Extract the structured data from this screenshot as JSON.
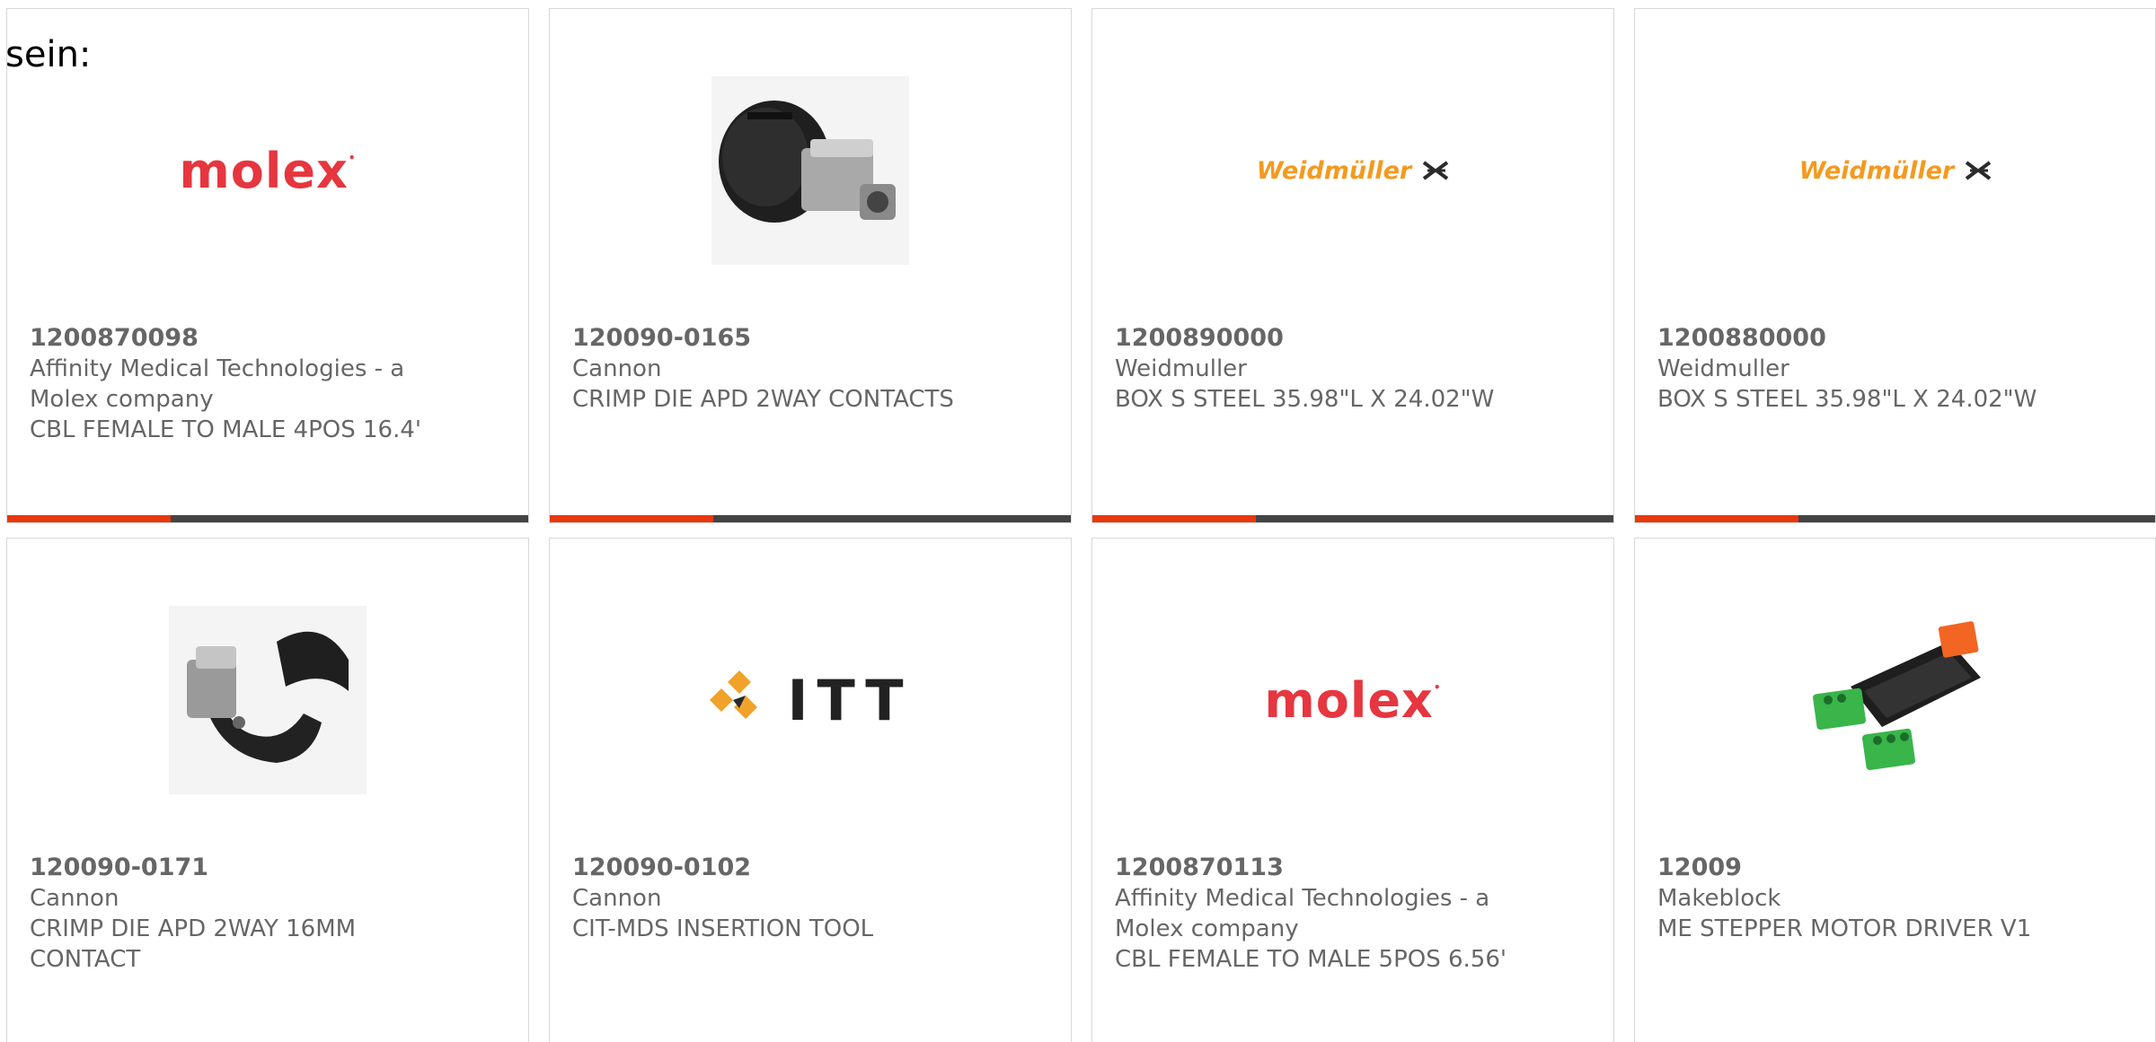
{
  "page": {
    "label": "sein:"
  },
  "products": [
    {
      "part_number": "1200870098",
      "manufacturer": "Affinity Medical Technologies - a Molex company",
      "description": "CBL FEMALE TO MALE 4POS 16.4'",
      "image": "molex-logo",
      "logo_text": "molex"
    },
    {
      "part_number": "120090-0165",
      "manufacturer": "Cannon",
      "description": "CRIMP DIE APD 2WAY CONTACTS",
      "image": "crimp-die-photo"
    },
    {
      "part_number": "1200890000",
      "manufacturer": "Weidmuller",
      "description": "BOX S STEEL 35.98\"L X 24.02\"W",
      "image": "weidmuller-logo",
      "logo_text": "Weidmüller"
    },
    {
      "part_number": "1200880000",
      "manufacturer": "Weidmuller",
      "description": "BOX S STEEL 35.98\"L X 24.02\"W",
      "image": "weidmuller-logo",
      "logo_text": "Weidmüller"
    },
    {
      "part_number": "120090-0171",
      "manufacturer": "Cannon",
      "description": "CRIMP DIE APD 2WAY 16MM CONTACT",
      "image": "crimp-die-open-photo"
    },
    {
      "part_number": "120090-0102",
      "manufacturer": "Cannon",
      "description": "CIT-MDS INSERTION TOOL",
      "image": "itt-logo",
      "logo_text": "ITT"
    },
    {
      "part_number": "1200870113",
      "manufacturer": "Affinity Medical Technologies - a Molex company",
      "description": "CBL FEMALE TO MALE 5POS 6.56'",
      "image": "molex-logo",
      "logo_text": "molex"
    },
    {
      "part_number": "12009",
      "manufacturer": "Makeblock",
      "description": "ME STEPPER MOTOR DRIVER V1",
      "image": "stepper-driver-photo"
    }
  ],
  "colors": {
    "accent": "#e8380d",
    "bar": "#444444",
    "text": "#666666",
    "border": "#d8d8d8",
    "molex_red": "#e6363f",
    "weidmuller_orange": "#f39a1f"
  }
}
